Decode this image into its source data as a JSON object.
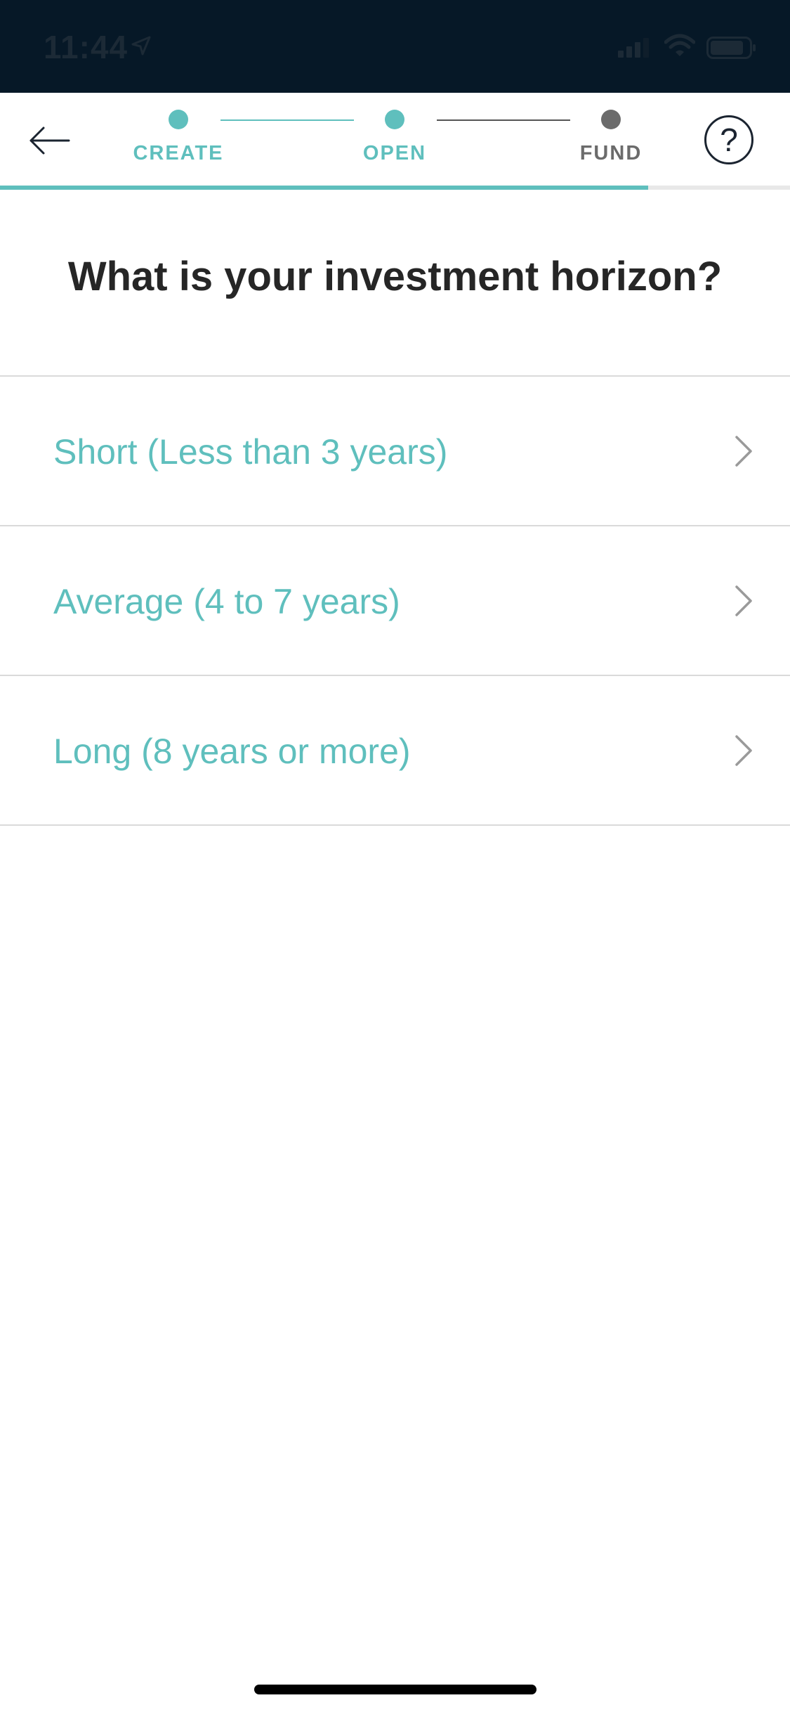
{
  "status_bar": {
    "time": "11:44",
    "icons": [
      "location-arrow-icon",
      "signal-icon",
      "wifi-icon",
      "battery-icon"
    ]
  },
  "header": {
    "back_icon": "arrow-left-icon",
    "help_label": "?",
    "steps": [
      {
        "label": "CREATE",
        "state": "complete"
      },
      {
        "label": "OPEN",
        "state": "current"
      },
      {
        "label": "FUND",
        "state": "upcoming"
      }
    ],
    "progress_fraction": 0.82
  },
  "question": "What is your investment horizon?",
  "options": [
    {
      "label": "Short (Less than 3 years)",
      "icon": "chevron-right-icon"
    },
    {
      "label": "Average (4 to 7 years)",
      "icon": "chevron-right-icon"
    },
    {
      "label": "Long (8 years or more)",
      "icon": "chevron-right-icon"
    }
  ],
  "colors": {
    "accent": "#5fbfbd",
    "status_bar_bg": "#061827",
    "upcoming_step": "#6b6b6b",
    "text_dark": "#262626"
  }
}
